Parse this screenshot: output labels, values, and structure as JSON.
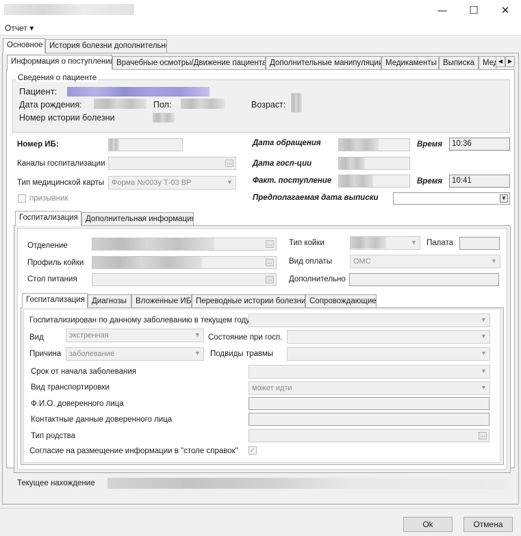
{
  "window": {
    "minimize_glyph": "—",
    "maximize_glyph": "☐",
    "close_glyph": "✕"
  },
  "menu": {
    "report": "Отчет ▾"
  },
  "main_tabs": [
    "Основное",
    "История болезни дополнительно"
  ],
  "sub_tabs": [
    "Информация о поступлении",
    "Врачебные осмотры/Движение пациента",
    "Дополнительные манипуляции",
    "Медикаменты",
    "Выписка",
    "Мед"
  ],
  "patient_info": {
    "group_title": "Сведения о пациенте",
    "patient_label": "Пациент:",
    "birth_label": "Дата рождения:",
    "sex_label": "Пол:",
    "age_label": "Возраст:",
    "history_label": "Номер истории болезни"
  },
  "admission": {
    "ib_number_label": "Номер ИБ:",
    "channels_label": "Каналы госпитализации",
    "card_type_label": "Тип медицинской карты",
    "card_type_value": "Форма №003у Т-03 ВР",
    "conscript_label": "призывник",
    "visit_date_label": "Дата обращения",
    "time_label": "Время",
    "visit_time_value": "10:36",
    "hosp_date_label": "Дата госп-ции",
    "actual_arrival_label": "Факт. поступление",
    "actual_time_value": "10:41",
    "expected_discharge_label": "Предполагаемая дата выписки"
  },
  "hosp_tabs": [
    "Госпитализация",
    "Дополнительная информация"
  ],
  "hosp": {
    "department_label": "Отделение",
    "bed_profile_label": "Профиль койки",
    "diet_label": "Стол питания",
    "bed_type_label": "Тип койки",
    "ward_label": "Палата",
    "payment_label": "Вид оплаты",
    "payment_value": "ОМС",
    "extra_label": "Дополнительно"
  },
  "inner_tabs": [
    "Госпитализация",
    "Диагнозы",
    "Вложенные ИБ",
    "Переводные истории болезни",
    "Сопровождающие"
  ],
  "inner": {
    "hospitalized_label": "Госпитализирован по данному заболеванию в текущем году",
    "kind_label": "Вид",
    "kind_value": "экстренная",
    "state_label": "Состояние при госп.",
    "reason_label": "Причина",
    "reason_value": "заболевание",
    "trauma_label": "Подвиды травмы",
    "term_label": "Срок от начала заболевания",
    "transport_label": "Вид транспортировки",
    "transport_value": "может идти",
    "trustee_name_label": "Ф.И.О. доверенного лица",
    "trustee_contacts_label": "Контактные данные доверенного лица",
    "relation_label": "Тип родства",
    "consent_label": "Согласие на размещение информации в \"столе справок\""
  },
  "current_location_label": "Текущее нахождение",
  "buttons": {
    "ok": "Ok",
    "cancel": "Отмена"
  }
}
